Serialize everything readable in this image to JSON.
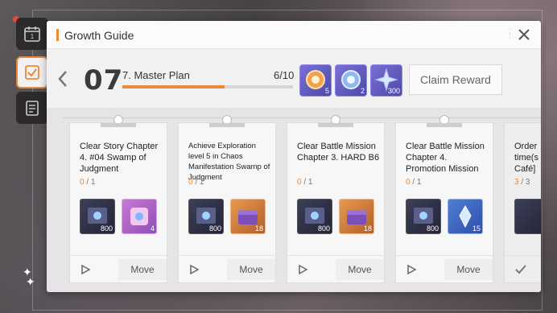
{
  "sidebar": {
    "tabs": [
      {
        "icon": "calendar-icon",
        "label": "1"
      },
      {
        "icon": "checklist-icon"
      },
      {
        "icon": "document-icon"
      }
    ]
  },
  "window": {
    "title": "Growth Guide"
  },
  "chapter": {
    "number": "07",
    "plan_name": "7. Master Plan",
    "progress_text": "6/10",
    "progress_fraction": 0.6
  },
  "rewards": [
    {
      "icon": "orange-orb-icon",
      "qty": "5"
    },
    {
      "icon": "blue-orb-icon",
      "qty": "2"
    },
    {
      "icon": "crystal-star-icon",
      "qty": "300"
    }
  ],
  "claim_label": "Claim Reward",
  "missions": [
    {
      "title": "Clear Story Chapter 4. #04 Swamp of Judgment",
      "current": "0",
      "total": "1",
      "items": [
        {
          "icon": "book-icon",
          "qty": "800"
        },
        {
          "icon": "pink-box-icon",
          "qty": "4"
        }
      ],
      "move_label": "Move"
    },
    {
      "title": "Achieve Exploration level 5 in Chaos Manifestation Swamp of Judgment",
      "current": "0",
      "total": "1",
      "items": [
        {
          "icon": "book-icon",
          "qty": "800"
        },
        {
          "icon": "purple-chest-icon",
          "qty": "18"
        }
      ],
      "move_label": "Move"
    },
    {
      "title": "Clear Battle Mission Chapter 3. HARD B6",
      "current": "0",
      "total": "1",
      "items": [
        {
          "icon": "book-icon",
          "qty": "800"
        },
        {
          "icon": "purple-chest-icon",
          "qty": "18"
        }
      ],
      "move_label": "Move"
    },
    {
      "title": "Clear Battle Mission Chapter 4. Promotion Mission",
      "current": "0",
      "total": "1",
      "items": [
        {
          "icon": "book-icon",
          "qty": "800"
        },
        {
          "icon": "crystal-shard-icon",
          "qty": "15"
        }
      ],
      "move_label": "Move"
    },
    {
      "title": "Order time(s Café]",
      "current": "3",
      "total": "3"
    }
  ],
  "colors": {
    "accent": "#e8893b",
    "panel_bg": "#f2f1f2"
  }
}
